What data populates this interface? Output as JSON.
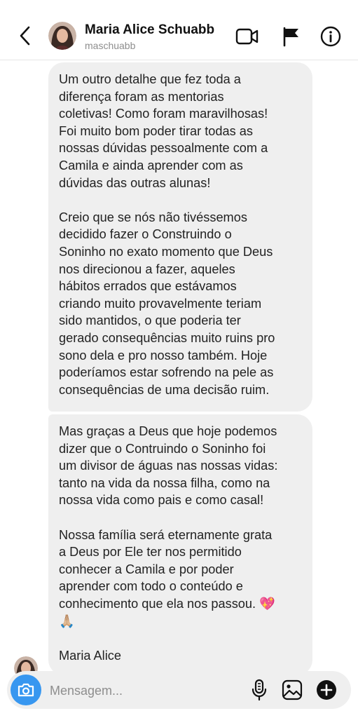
{
  "header": {
    "name": "Maria Alice Schuabb",
    "username": "maschuabb",
    "icons": [
      "back-icon",
      "video-icon",
      "flag-icon",
      "info-icon"
    ]
  },
  "messages": [
    {
      "paragraphs": [
        "Um outro detalhe que fez toda a\ndiferença foram as mentorias\ncoletivas! Como foram maravilhosas!\nFoi muito bom poder tirar todas as\nnossas dúvidas pessoalmente com a\nCamila e ainda aprender com as\ndúvidas das outras alunas!",
        "Creio que se nós não tivéssemos\ndecidido fazer o Construindo o\nSoninho no exato momento que Deus\nnos direcionou a fazer, aqueles\nhábitos errados que estávamos\ncriando muito provavelmente teriam\nsido mantidos, o que poderia ter\ngerado consequências muito ruins pro\nsono dela e pro nosso também. Hoje\npoderíamos estar sofrendo na pele as\nconsequências de uma decisão ruim."
      ]
    },
    {
      "paragraphs": [
        "Mas graças a Deus que hoje podemos\ndizer que o Contruindo o Soninho foi\num divisor de águas nas nossas vidas:\ntanto na vida da nossa filha, como na\nnossa vida como pais e como casal!",
        "Nossa família será eternamente grata\na Deus por Ele ter nos permitido\nconhecer a Camila e por poder\naprender com todo o conteúdo e\nconhecimento que ela nos passou. 💖\n🙏🏼",
        "Maria Alice"
      ]
    }
  ],
  "composer": {
    "placeholder": "Mensagem...",
    "icons": [
      "camera-icon",
      "microphone-icon",
      "gallery-icon",
      "plus-icon"
    ]
  },
  "colors": {
    "bubble": "#efefef",
    "camera_button": "#3897f0",
    "secondary_text": "#8e8e8e"
  }
}
